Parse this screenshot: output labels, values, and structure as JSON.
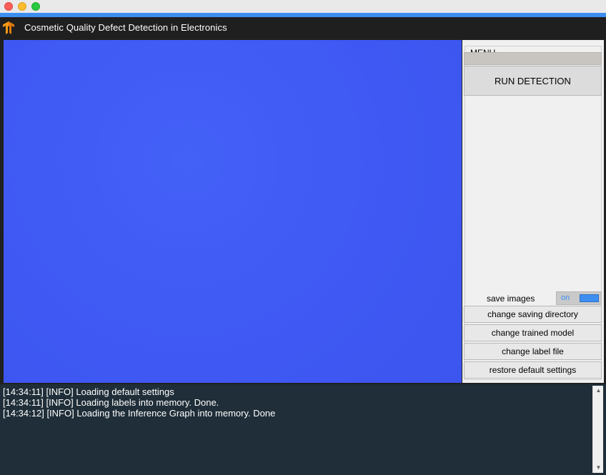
{
  "window": {
    "title": "Cosmetic Quality Defect Detection in Electronics",
    "logo_icon": "tensorflow-logo-icon",
    "accent_color": "#3d8ef1"
  },
  "viewer": {
    "background_color": "#3f59f5"
  },
  "menu": {
    "group_label": "MENU",
    "run_button_label": "RUN DETECTION",
    "save_images_label": "save images",
    "save_images_toggle": "on",
    "buttons": [
      {
        "label": "change saving directory"
      },
      {
        "label": "change trained model"
      },
      {
        "label": "change label file"
      },
      {
        "label": "restore default settings"
      }
    ]
  },
  "log": {
    "lines": [
      "[14:34:11] [INFO] Loading default settings",
      "[14:34:11] [INFO] Loading labels into memory. Done.",
      "[14:34:12] [INFO] Loading the Inference Graph into memory. Done"
    ]
  }
}
